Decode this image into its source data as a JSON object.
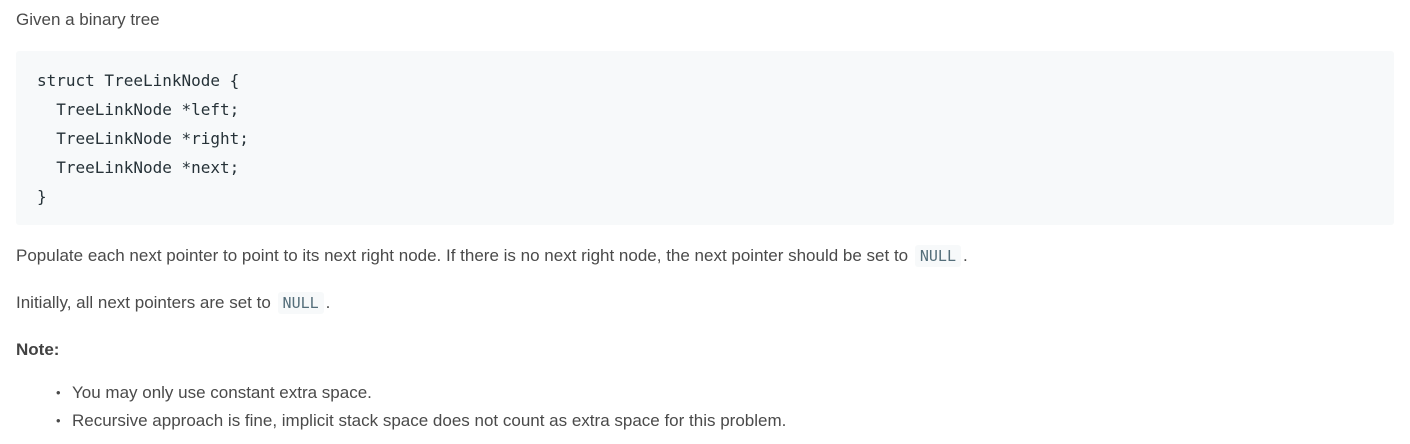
{
  "intro": "Given a binary tree",
  "code": {
    "lines": [
      "struct TreeLinkNode {",
      "  TreeLinkNode *left;",
      "  TreeLinkNode *right;",
      "  TreeLinkNode *next;",
      "}"
    ]
  },
  "populate": {
    "text": "Populate each next pointer to point to its next right node. If there is no next right node, the next pointer should be set to",
    "code": "NULL",
    "end": "."
  },
  "initially": {
    "text": "Initially, all next pointers are set to",
    "code": "NULL",
    "end": "."
  },
  "note": {
    "heading": "Note:",
    "items": [
      "You may only use constant extra space.",
      "Recursive approach is fine, implicit stack space does not count as extra space for this problem."
    ]
  }
}
